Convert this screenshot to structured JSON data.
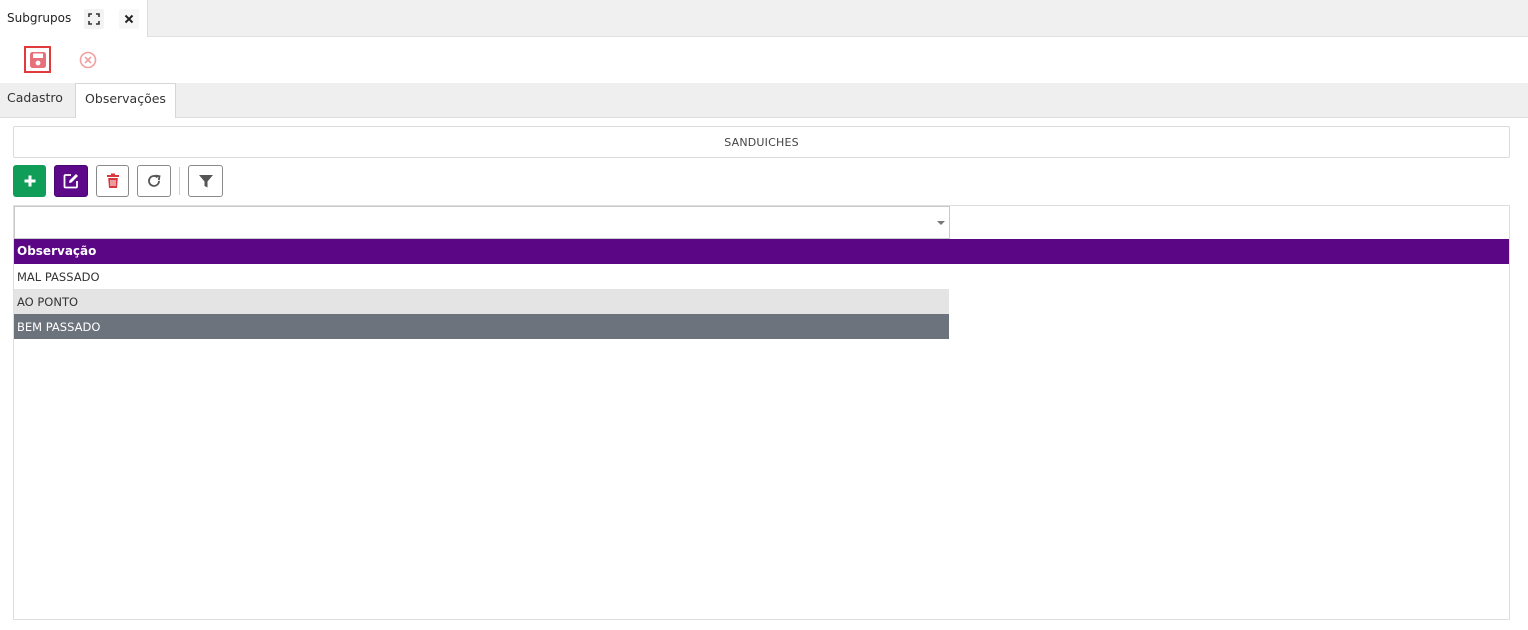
{
  "window_tab": {
    "title": "Subgrupos",
    "maximize_icon": "maximize-icon",
    "close_icon": "close-icon"
  },
  "toolbar": {
    "save_icon": "save-icon",
    "cancel_icon": "cancel-circle-icon",
    "colors": {
      "save_border": "#e03a3a",
      "save_icon": "#e8707a",
      "cancel_icon": "#f0a0a0"
    }
  },
  "tabs": [
    {
      "label": "Cadastro",
      "active": false
    },
    {
      "label": "Observações",
      "active": true
    }
  ],
  "group_name": "SANDUICHES",
  "actions": {
    "add_icon": "plus-icon",
    "edit_icon": "edit-icon",
    "delete_icon": "trash-icon",
    "refresh_icon": "refresh-icon",
    "filter_icon": "filter-icon",
    "colors": {
      "add": "#0f9d58",
      "edit": "#5d0a8a",
      "delete_icon": "#d9363e"
    }
  },
  "grid": {
    "select_value": "",
    "column_header": "Observação",
    "rows": [
      "MAL PASSADO",
      "AO PONTO",
      "BEM PASSADO"
    ],
    "selected_row": 2,
    "colors": {
      "header": "#5b0684",
      "alt_row": "#e4e4e4",
      "selected_row": "#6c737c"
    }
  }
}
